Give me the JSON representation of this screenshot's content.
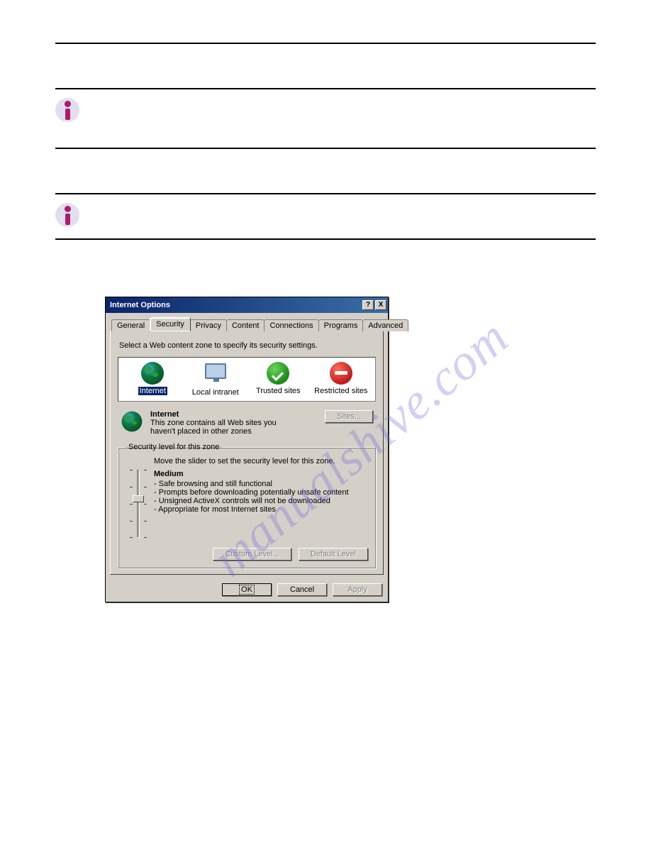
{
  "watermark": "manualshive.com",
  "dialog": {
    "title": "Internet Options",
    "help_btn": "?",
    "close_btn": "X",
    "tabs": [
      "General",
      "Security",
      "Privacy",
      "Content",
      "Connections",
      "Programs",
      "Advanced"
    ],
    "selected_tab_index": 1,
    "zone_instruction": "Select a Web content zone to specify its security settings.",
    "zones": [
      {
        "label": "Internet"
      },
      {
        "label": "Local intranet"
      },
      {
        "label": "Trusted sites"
      },
      {
        "label": "Restricted sites"
      }
    ],
    "selected_zone_index": 0,
    "zone_header": {
      "title": "Internet",
      "desc": "This zone contains all Web sites you haven't placed in other zones"
    },
    "sites_btn": "Sites...",
    "group_legend": "Security level for this zone",
    "group_hint": "Move the slider to set the security level for this zone.",
    "level_title": "Medium",
    "level_points": [
      "Safe browsing and still functional",
      "Prompts before downloading potentially unsafe content",
      "Unsigned ActiveX controls will not be downloaded",
      "Appropriate for most Internet sites"
    ],
    "custom_level_btn": "Custom Level...",
    "default_level_btn": "Default Level",
    "ok_btn": "OK",
    "cancel_btn": "Cancel",
    "apply_btn": "Apply"
  }
}
